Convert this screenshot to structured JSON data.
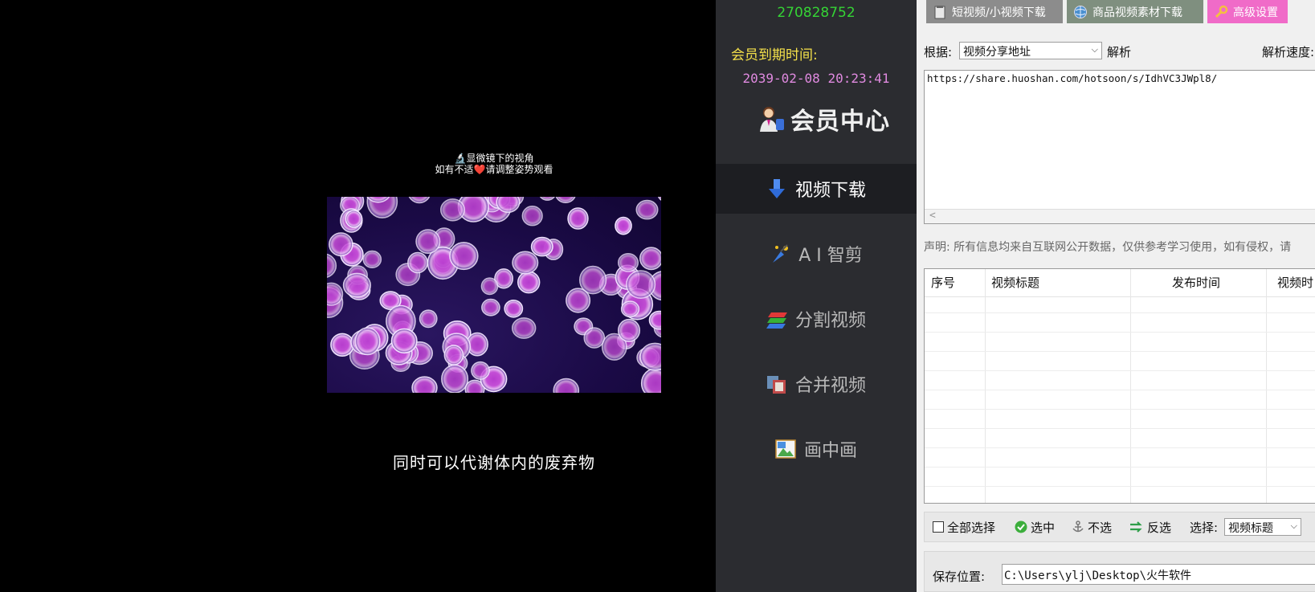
{
  "video": {
    "caption_line1": "🔬显微镜下的视角",
    "caption_line2": "如有不适❤️请调整姿势观看",
    "subtitle": "同时可以代谢体内的废弃物"
  },
  "nav": {
    "member_id": "270828752",
    "expire_label": "会员到期时间:",
    "expire_time": "2039-02-08 20:23:41",
    "member_center": "会员中心",
    "items": [
      {
        "label": "视频下载",
        "icon": "download-arrow-icon",
        "active": true
      },
      {
        "label": "A I 智剪",
        "icon": "ai-edit-icon",
        "active": false
      },
      {
        "label": "分割视频",
        "icon": "split-video-icon",
        "active": false
      },
      {
        "label": "合并视频",
        "icon": "merge-video-icon",
        "active": false
      },
      {
        "label": "画中画",
        "icon": "picture-in-picture-icon",
        "active": false
      }
    ]
  },
  "tabs": [
    {
      "label": "短视频/小视频下载",
      "color": "#8a8a8a"
    },
    {
      "label": "商品视频素材下载",
      "color": "#7a8a7a"
    },
    {
      "label": "高级设置",
      "color": "#f06bc8"
    }
  ],
  "parse": {
    "basis_label": "根据:",
    "basis_value": "视频分享地址",
    "parse_label": "解析",
    "speed_label": "解析速度:"
  },
  "url_text": "https://share.huoshan.com/hotsoon/s/IdhVC3JWpl8/",
  "notice": "声明: 所有信息均来自互联网公开数据，仅供参考学习使用，如有侵权，请",
  "table": {
    "headers": [
      "序号",
      "视频标题",
      "发布时间",
      "视频时"
    ]
  },
  "actions": {
    "select_all": "全部选择",
    "select": "选中",
    "deselect": "不选",
    "invert": "反选",
    "choose_label": "选择:",
    "choose_value": "视频标题"
  },
  "save": {
    "label": "保存位置:",
    "path": "C:\\Users\\ylj\\Desktop\\火牛软件"
  }
}
